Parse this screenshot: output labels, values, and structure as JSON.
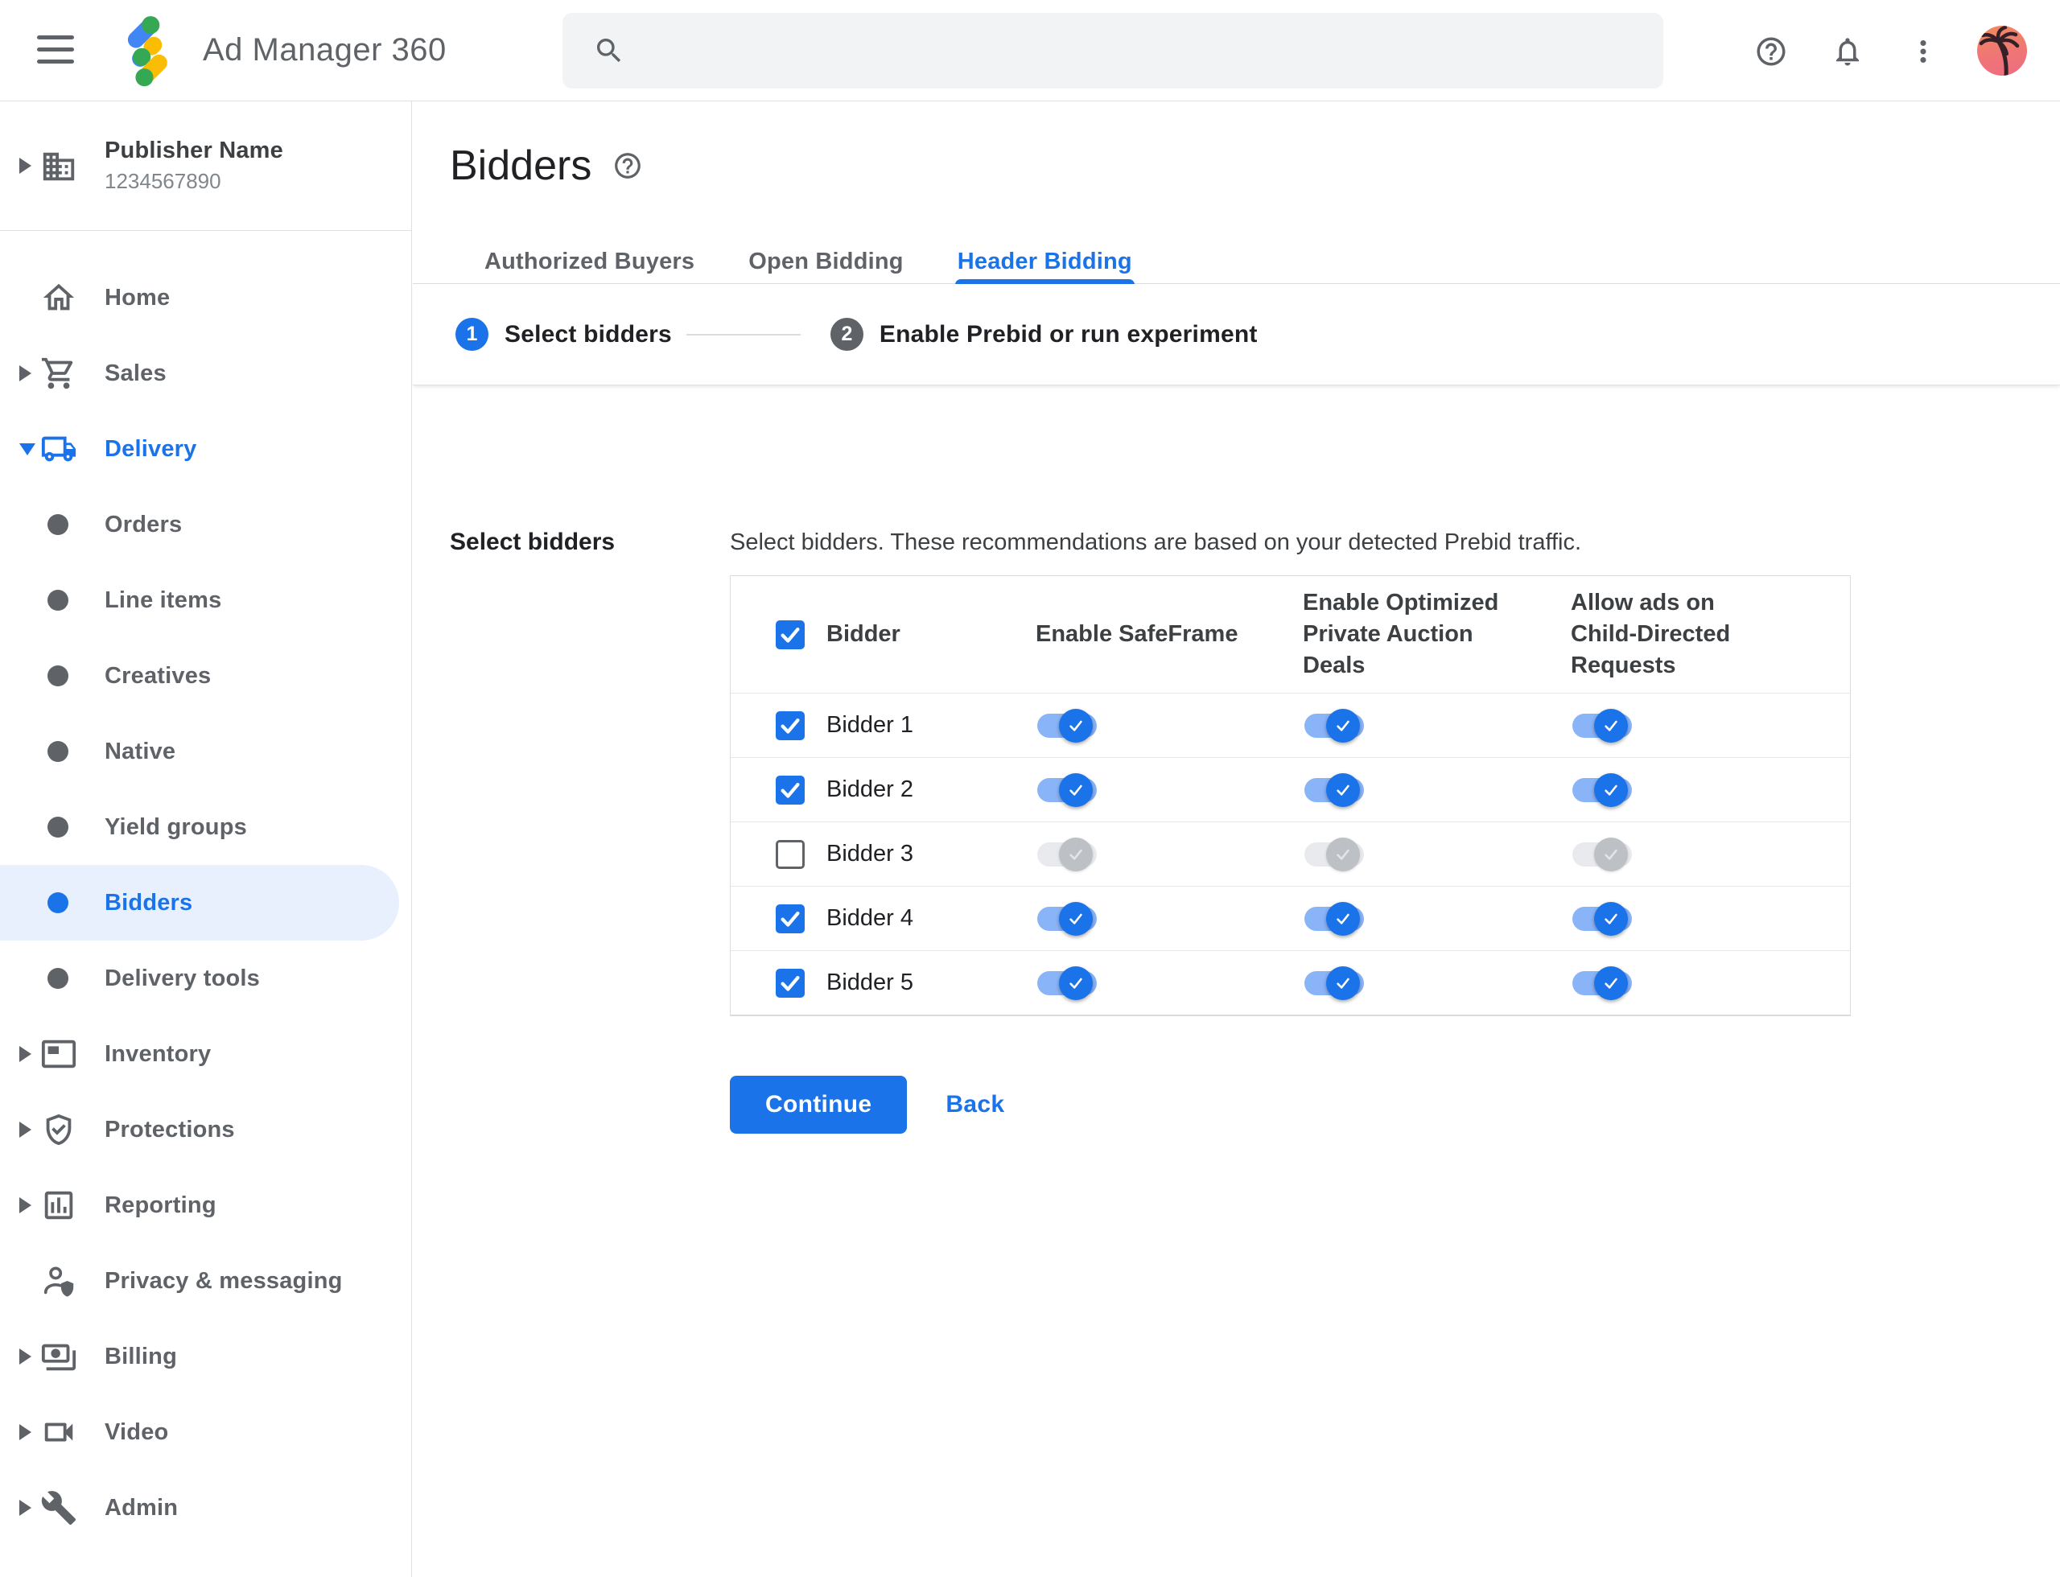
{
  "colors": {
    "accent_blue": "#1a73e8",
    "toggle_track_blue": "#8ab4f8",
    "disabled_gray": "#bdc1c6",
    "selected_item_bg": "#e8f0fe",
    "text_gray": "#5f6368",
    "text_dark": "#202124",
    "border": "#dadce0",
    "search_bg": "#f1f3f4"
  },
  "header": {
    "app_title": "Ad Manager 360",
    "search_placeholder": "",
    "icons": [
      "menu-icon",
      "ad-manager-logo",
      "search-icon",
      "help-icon",
      "notifications-icon",
      "more-vert-icon",
      "avatar"
    ]
  },
  "sidebar": {
    "publisher": {
      "name": "Publisher Name",
      "id": "1234567890"
    },
    "items": [
      {
        "label": "Home",
        "icon": "home"
      },
      {
        "label": "Sales",
        "icon": "cart",
        "arrow": "collapsed"
      },
      {
        "label": "Delivery",
        "icon": "truck",
        "arrow": "expanded",
        "parent_active": true
      },
      {
        "label": "Orders",
        "bullet": true
      },
      {
        "label": "Line items",
        "bullet": true
      },
      {
        "label": "Creatives",
        "bullet": true
      },
      {
        "label": "Native",
        "bullet": true
      },
      {
        "label": "Yield groups",
        "bullet": true
      },
      {
        "label": "Bidders",
        "bullet": true,
        "selected": true
      },
      {
        "label": "Delivery tools",
        "bullet": true
      },
      {
        "label": "Inventory",
        "icon": "inventory",
        "arrow": "collapsed"
      },
      {
        "label": "Protections",
        "icon": "shield",
        "arrow": "collapsed"
      },
      {
        "label": "Reporting",
        "icon": "chart",
        "arrow": "collapsed"
      },
      {
        "label": "Privacy & messaging",
        "icon": "privacy"
      },
      {
        "label": "Billing",
        "icon": "billing",
        "arrow": "collapsed"
      },
      {
        "label": "Video",
        "icon": "video",
        "arrow": "collapsed"
      },
      {
        "label": "Admin",
        "icon": "admin",
        "arrow": "collapsed"
      }
    ]
  },
  "main": {
    "title": "Bidders",
    "tabs": [
      {
        "label": "Authorized Buyers",
        "active": false
      },
      {
        "label": "Open Bidding",
        "active": false
      },
      {
        "label": "Header Bidding",
        "active": true
      }
    ],
    "stepper": [
      {
        "num": "1",
        "label": "Select bidders",
        "active": true
      },
      {
        "num": "2",
        "label": "Enable Prebid or run experiment",
        "active": false
      }
    ],
    "section_label": "Select bidders",
    "description": "Select bidders. These recommendations are based on your detected Prebid traffic.",
    "table": {
      "columns": [
        "Bidder",
        "Enable SafeFrame",
        "Enable Optimized Private Auction Deals",
        "Allow ads on Child-Directed Requests"
      ],
      "header_checkbox_checked": true,
      "rows": [
        {
          "name": "Bidder 1",
          "checked": true,
          "toggles": [
            true,
            true,
            true
          ]
        },
        {
          "name": "Bidder 2",
          "checked": true,
          "toggles": [
            true,
            true,
            true
          ]
        },
        {
          "name": "Bidder 3",
          "checked": false,
          "toggles": [
            false,
            false,
            false
          ]
        },
        {
          "name": "Bidder 4",
          "checked": true,
          "toggles": [
            true,
            true,
            true
          ]
        },
        {
          "name": "Bidder 5",
          "checked": true,
          "toggles": [
            true,
            true,
            true
          ]
        }
      ]
    },
    "continue_label": "Continue",
    "back_label": "Back"
  }
}
